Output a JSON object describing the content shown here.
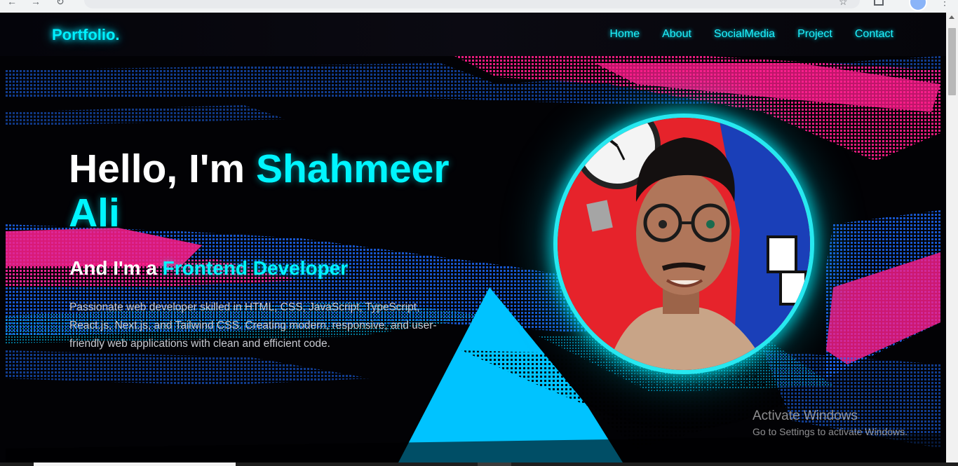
{
  "browser": {
    "icons": [
      "back-arrow-icon",
      "forward-arrow-icon",
      "reload-icon",
      "bookmark-star-icon",
      "tab-search-icon",
      "profile-icon",
      "menu-icon"
    ]
  },
  "navbar": {
    "brand": "Portfolio.",
    "links": [
      "Home",
      "About",
      "SocialMedia",
      "Project",
      "Contact"
    ]
  },
  "hero": {
    "title_prefix": "Hello, I'm ",
    "name": "Shahmeer Ali",
    "subtitle_prefix": "And I'm a ",
    "role": "Frontend Developer",
    "description": "Passionate web developer skilled in HTML, CSS, JavaScript, TypeScript, React.js, Next.js, and Tailwind CSS. Creating modern, responsive, and user-friendly web applications with clean and efficient code."
  },
  "watermark": {
    "title": "Activate Windows",
    "subtitle": "Go to Settings to activate Windows."
  },
  "colors": {
    "accent": "#00f5ff",
    "background": "#000000",
    "glitch_pink": "#ff1e8c",
    "glitch_blue": "#1e6bff",
    "glitch_cyan": "#00c8ff"
  }
}
